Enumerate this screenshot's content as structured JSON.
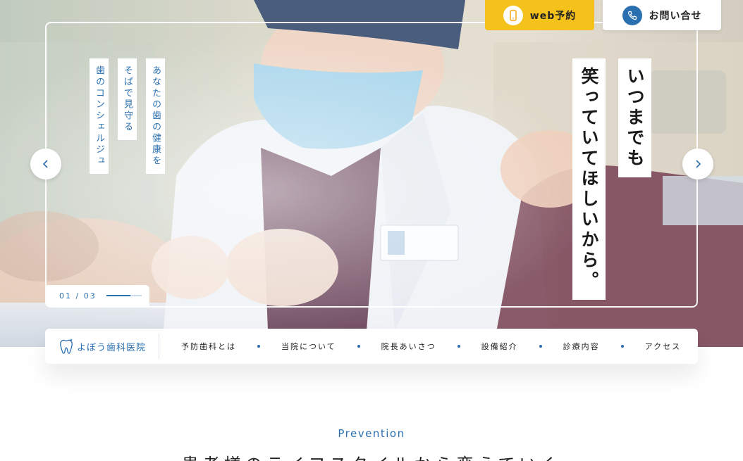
{
  "hero": {
    "tags": [
      "あなたの歯の健康を",
      "そばで見守る",
      "歯のコンシェルジュ"
    ],
    "headline": [
      "いつまでも",
      "笑っていてほしいから。"
    ],
    "counter": "01 / 03"
  },
  "header": {
    "web_reserve": "web予約",
    "contact": "お問い合せ"
  },
  "nav": {
    "logo": "よぼう歯科医院",
    "items": [
      "予防歯科とは",
      "当院について",
      "院長あいさつ",
      "設備紹介",
      "診療内容",
      "アクセス"
    ]
  },
  "section": {
    "label": "Prevention",
    "heading": "患者様のライフスタイルから変えていく"
  },
  "colors": {
    "accent": "#2a6fb0",
    "button_yellow": "#f5c21b"
  }
}
